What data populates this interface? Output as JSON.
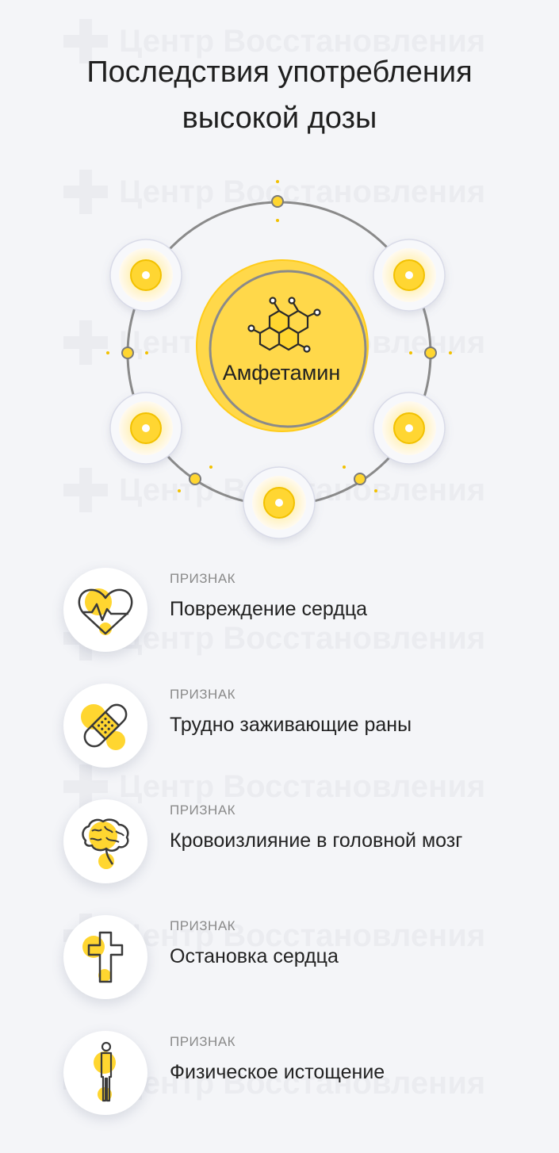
{
  "watermark": "Центр Восстановления",
  "title": {
    "line1": "Последствия употребления",
    "line2": "высокой дозы"
  },
  "center": {
    "label": "Амфетамин",
    "icon": "molecule-icon"
  },
  "colors": {
    "accent": "#ffd630",
    "accent_dark": "#f2c100",
    "ring": "#8a8a8a",
    "background": "#f4f5f8"
  },
  "signs": [
    {
      "kicker": "ПРИЗНАК",
      "text": "Повреждение сердца",
      "icon": "heart-pulse-icon"
    },
    {
      "kicker": "ПРИЗНАК",
      "text": "Трудно заживающие раны",
      "icon": "bandage-icon"
    },
    {
      "kicker": "ПРИЗНАК",
      "text": "Кровоизлияние в головной мозг",
      "icon": "brain-icon"
    },
    {
      "kicker": "ПРИЗНАК",
      "text": "Остановка сердца",
      "icon": "cross-icon"
    },
    {
      "kicker": "ПРИЗНАК",
      "text": "Физическое истощение",
      "icon": "person-icon"
    }
  ]
}
